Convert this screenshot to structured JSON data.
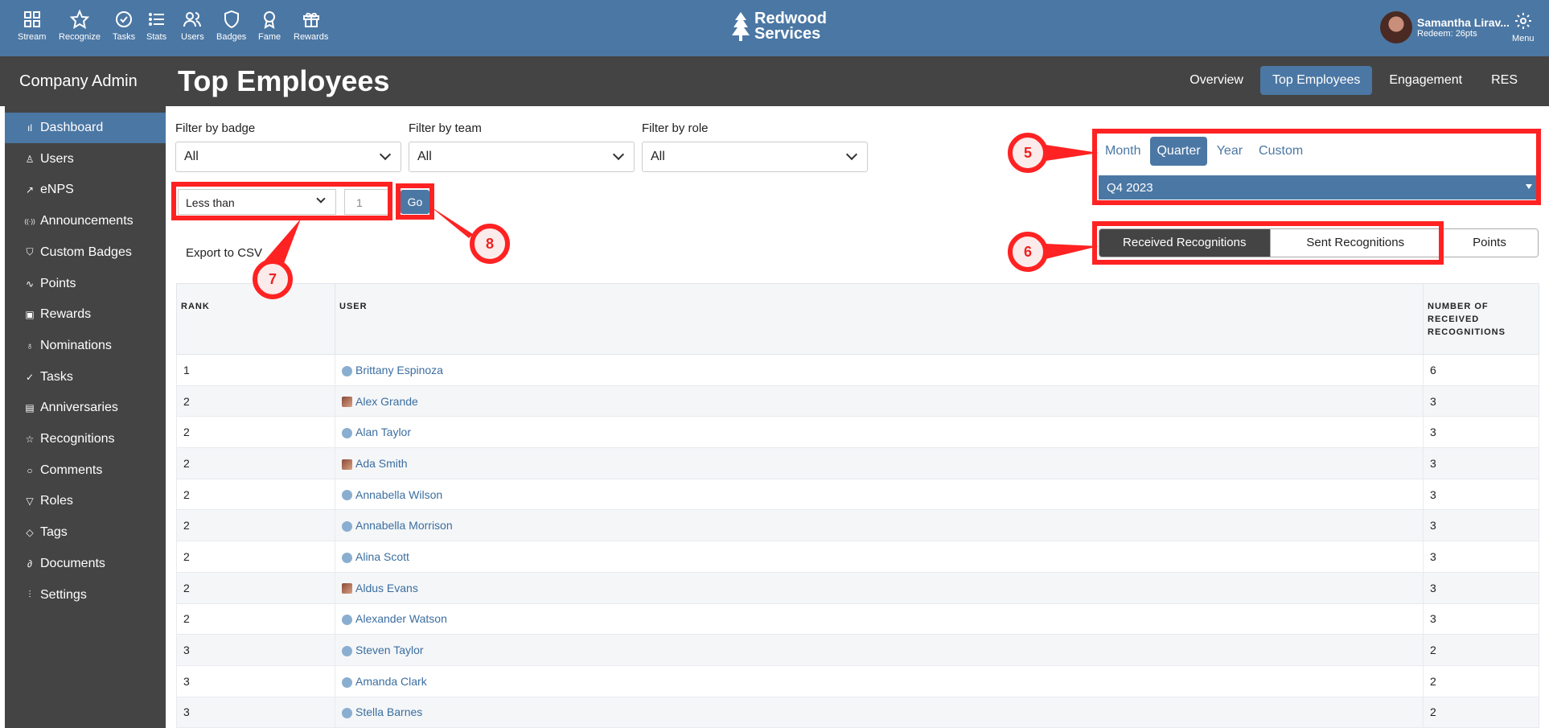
{
  "topnav": {
    "items": [
      {
        "label": "Stream",
        "icon": "grid-icon"
      },
      {
        "label": "Recognize",
        "icon": "star-icon"
      },
      {
        "label": "Tasks",
        "icon": "check-circle-icon"
      },
      {
        "label": "Stats",
        "icon": "list-icon"
      },
      {
        "label": "Users",
        "icon": "users-icon"
      },
      {
        "label": "Badges",
        "icon": "shield-icon"
      },
      {
        "label": "Fame",
        "icon": "award-icon"
      },
      {
        "label": "Rewards",
        "icon": "gift-icon"
      }
    ],
    "brand_line1": "Redwood",
    "brand_line2": "Services",
    "user_name": "Samantha Lirav...",
    "user_redeem": "Redeem: 26pts",
    "menu_label": "Menu"
  },
  "header": {
    "section": "Company Admin",
    "title": "Top Employees",
    "tabs": [
      "Overview",
      "Top Employees",
      "Engagement",
      "RES"
    ],
    "active_tab": "Top Employees"
  },
  "sidebar": {
    "items": [
      {
        "label": "Dashboard",
        "icon": "bar-chart-icon",
        "glyph": "ıl"
      },
      {
        "label": "Users",
        "icon": "user-icon",
        "glyph": "♙"
      },
      {
        "label": "eNPS",
        "icon": "trend-icon",
        "glyph": "↗"
      },
      {
        "label": "Announcements",
        "icon": "broadcast-icon",
        "glyph": "((·))"
      },
      {
        "label": "Custom Badges",
        "icon": "shield-icon",
        "glyph": "⛉"
      },
      {
        "label": "Points",
        "icon": "pulse-icon",
        "glyph": "∿"
      },
      {
        "label": "Rewards",
        "icon": "gift-icon",
        "glyph": "▣"
      },
      {
        "label": "Nominations",
        "icon": "award-icon",
        "glyph": "♁"
      },
      {
        "label": "Tasks",
        "icon": "check-circle-icon",
        "glyph": "✓"
      },
      {
        "label": "Anniversaries",
        "icon": "calendar-icon",
        "glyph": "▤"
      },
      {
        "label": "Recognitions",
        "icon": "star-icon",
        "glyph": "☆"
      },
      {
        "label": "Comments",
        "icon": "comment-icon",
        "glyph": "○"
      },
      {
        "label": "Roles",
        "icon": "filter-icon",
        "glyph": "▽"
      },
      {
        "label": "Tags",
        "icon": "tag-icon",
        "glyph": "◇"
      },
      {
        "label": "Documents",
        "icon": "paperclip-icon",
        "glyph": "∂"
      },
      {
        "label": "Settings",
        "icon": "sliders-icon",
        "glyph": "⫶"
      }
    ],
    "active": "Dashboard"
  },
  "filters": {
    "badge_label": "Filter by badge",
    "badge_value": "All",
    "team_label": "Filter by team",
    "team_value": "All",
    "role_label": "Filter by role",
    "role_value": "All",
    "comparison_value": "Less than",
    "threshold_placeholder": "1",
    "go_label": "Go",
    "export_label": "Export to CSV"
  },
  "range": {
    "tabs": [
      "Month",
      "Quarter",
      "Year",
      "Custom"
    ],
    "active": "Quarter",
    "selected_period": "Q4 2023"
  },
  "metric_toggle": {
    "options": [
      "Received Recognitions",
      "Sent Recognitions",
      "Points"
    ],
    "active": "Received Recognitions"
  },
  "table": {
    "headers": [
      "RANK",
      "USER",
      "NUMBER OF RECEIVED RECOGNITIONS"
    ],
    "rows": [
      {
        "rank": "1",
        "user": "Brittany Espinoza",
        "count": "6",
        "avatar": "default"
      },
      {
        "rank": "2",
        "user": "Alex Grande",
        "count": "3",
        "avatar": "photo"
      },
      {
        "rank": "2",
        "user": "Alan Taylor",
        "count": "3",
        "avatar": "default"
      },
      {
        "rank": "2",
        "user": "Ada Smith",
        "count": "3",
        "avatar": "photo"
      },
      {
        "rank": "2",
        "user": "Annabella Wilson",
        "count": "3",
        "avatar": "default"
      },
      {
        "rank": "2",
        "user": "Annabella Morrison",
        "count": "3",
        "avatar": "default"
      },
      {
        "rank": "2",
        "user": "Alina Scott",
        "count": "3",
        "avatar": "default"
      },
      {
        "rank": "2",
        "user": "Aldus Evans",
        "count": "3",
        "avatar": "photo"
      },
      {
        "rank": "2",
        "user": "Alexander Watson",
        "count": "3",
        "avatar": "default"
      },
      {
        "rank": "3",
        "user": "Steven Taylor",
        "count": "2",
        "avatar": "default"
      },
      {
        "rank": "3",
        "user": "Amanda Clark",
        "count": "2",
        "avatar": "default"
      },
      {
        "rank": "3",
        "user": "Stella Barnes",
        "count": "2",
        "avatar": "default"
      }
    ]
  },
  "annotations": {
    "callouts": [
      "5",
      "6",
      "7",
      "8"
    ],
    "color": "#ff2222"
  },
  "colors": {
    "primary": "#4b77a4",
    "dark": "#444444",
    "link": "#3b6ea0"
  }
}
